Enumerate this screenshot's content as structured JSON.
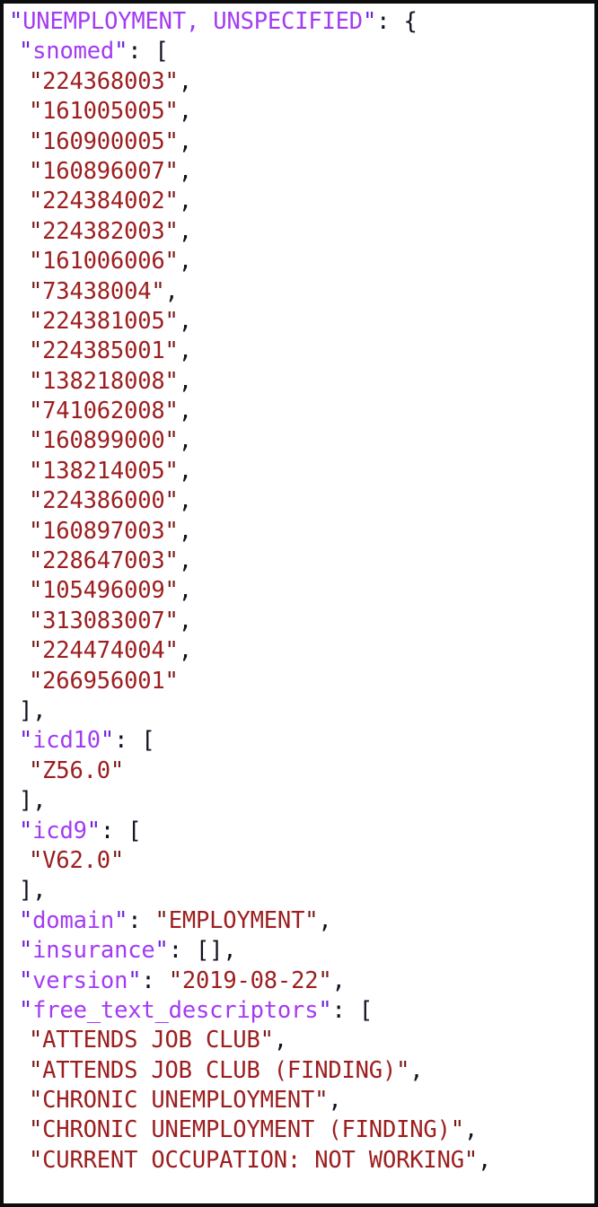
{
  "panel": {
    "border_color": "#0d0d0d",
    "background": "#ffffff"
  },
  "colors": {
    "key": "#a33bf2",
    "string_value": "#9c1f20",
    "punctuation": "#111122",
    "key_quote": "#6e25d8",
    "string_quote": "#7a1a1a"
  },
  "document": {
    "format": "json",
    "root_key": "UNEMPLOYMENT, UNSPECIFIED"
  },
  "record": {
    "name": "UNEMPLOYMENT, UNSPECIFIED",
    "snomed": [
      "224368003",
      "161005005",
      "160900005",
      "160896007",
      "224384002",
      "224382003",
      "161006006",
      "73438004",
      "224381005",
      "224385001",
      "138218008",
      "741062008",
      "160899000",
      "138214005",
      "224386000",
      "160897003",
      "228647003",
      "105496009",
      "313083007",
      "224474004",
      "266956001"
    ],
    "icd10": [
      "Z56.0"
    ],
    "icd9": [
      "V62.0"
    ],
    "domain": "EMPLOYMENT",
    "insurance": [],
    "version": "2019-08-22",
    "free_text_descriptors": [
      "ATTENDS JOB CLUB",
      "ATTENDS JOB CLUB (FINDING)",
      "CHRONIC UNEMPLOYMENT",
      "CHRONIC UNEMPLOYMENT (FINDING)",
      "CURRENT OCCUPATION: NOT WORKING"
    ]
  },
  "labels": {
    "key_snomed": "snomed",
    "key_icd10": "icd10",
    "key_icd9": "icd9",
    "key_domain": "domain",
    "key_insurance": "insurance",
    "key_version": "version",
    "key_free_text_descriptors": "free_text_descriptors"
  },
  "punctuation": {
    "quote": "\"",
    "colon_space": ": ",
    "open_brace": "{",
    "open_bracket": "[",
    "close_bracket_comma": "],",
    "empty_array_comma": "[],",
    "comma": ",",
    "empty": ""
  }
}
